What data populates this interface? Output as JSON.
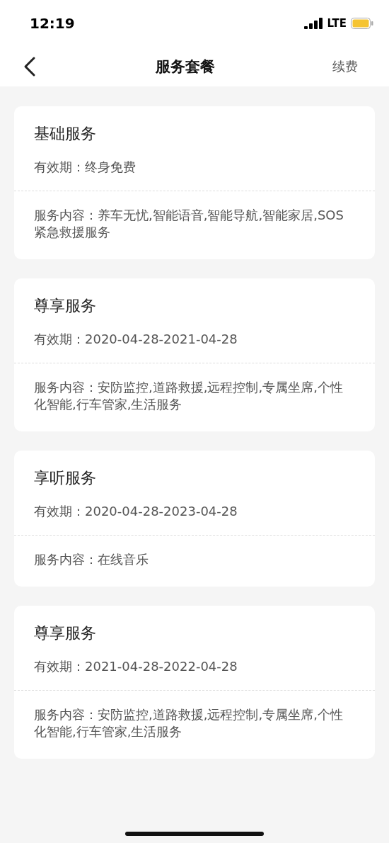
{
  "status_bar": {
    "time": "12:19",
    "network": "LTE"
  },
  "nav": {
    "title": "服务套餐",
    "action": "续费"
  },
  "packages": [
    {
      "name": "基础服务",
      "validity": "有效期：终身免费",
      "content": "服务内容：养车无忧,智能语音,智能导航,智能家居,SOS紧急救援服务"
    },
    {
      "name": "尊享服务",
      "validity": "有效期：2020-04-28-2021-04-28",
      "content": "服务内容：安防监控,道路救援,远程控制,专属坐席,个性化智能,行车管家,生活服务"
    },
    {
      "name": "享听服务",
      "validity": "有效期：2020-04-28-2023-04-28",
      "content": "服务内容：在线音乐"
    },
    {
      "name": "尊享服务",
      "validity": "有效期：2021-04-28-2022-04-28",
      "content": "服务内容：安防监控,道路救援,远程控制,专属坐席,个性化智能,行车管家,生活服务"
    }
  ]
}
